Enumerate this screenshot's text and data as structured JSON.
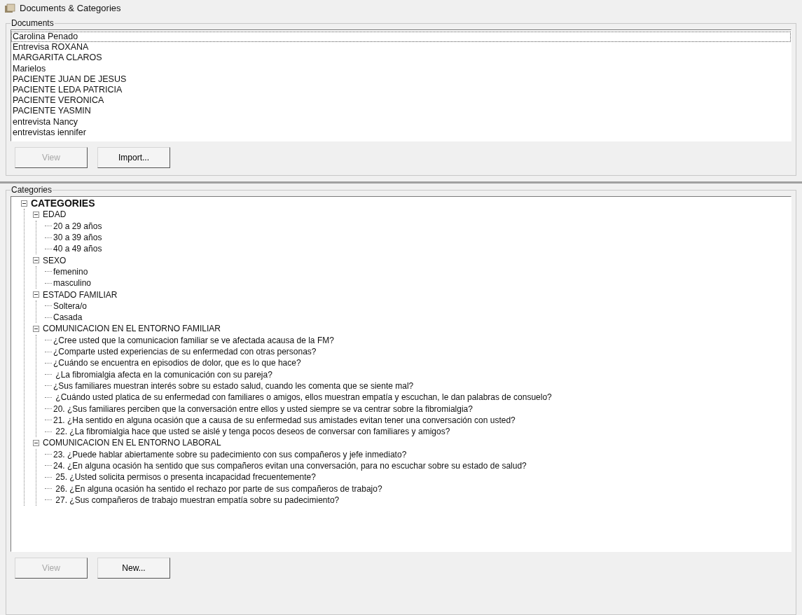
{
  "window": {
    "title": "Documents & Categories"
  },
  "documents": {
    "label": "Documents",
    "items": [
      {
        "label": "Carolina Penado",
        "focused": true
      },
      {
        "label": "Entrevisa ROXANA",
        "focused": false
      },
      {
        "label": "MARGARITA CLAROS",
        "focused": false
      },
      {
        "label": "Marielos",
        "focused": false
      },
      {
        "label": "PACIENTE JUAN DE JESUS",
        "focused": false
      },
      {
        "label": "PACIENTE LEDA PATRICIA",
        "focused": false
      },
      {
        "label": "PACIENTE VERONICA",
        "focused": false
      },
      {
        "label": "PACIENTE YASMIN",
        "focused": false
      },
      {
        "label": "entrevista Nancy",
        "focused": false
      },
      {
        "label": "entrevistas iennifer",
        "focused": false
      }
    ],
    "buttons": [
      {
        "label": "View",
        "disabled": true
      },
      {
        "label": "Import...",
        "disabled": false
      }
    ]
  },
  "categories": {
    "label": "Categories",
    "tree": [
      {
        "label": "CATEGORIES",
        "expanded": true,
        "children": [
          {
            "label": "EDAD",
            "expanded": true,
            "children": [
              {
                "label": "20 a 29 años"
              },
              {
                "label": "30 a 39 años"
              },
              {
                "label": "40 a 49 años"
              }
            ]
          },
          {
            "label": "SEXO",
            "expanded": true,
            "children": [
              {
                "label": "femenino"
              },
              {
                "label": "masculino"
              }
            ]
          },
          {
            "label": "ESTADO FAMILIAR",
            "expanded": true,
            "children": [
              {
                "label": "Soltera/o"
              },
              {
                "label": "Casada"
              }
            ]
          },
          {
            "label": "COMUNICACION EN EL ENTORNO FAMILIAR",
            "expanded": true,
            "children": [
              {
                "label": "¿Cree usted que la comunicacion familiar se ve afectada acausa de la FM?"
              },
              {
                "label": "¿Comparte usted experiencias de su enfermedad con otras personas?"
              },
              {
                "label": "¿Cuándo se encuentra en episodios de dolor, que es lo que hace?"
              },
              {
                "label": " ¿La fibromialgia afecta en la comunicación con su pareja?"
              },
              {
                "label": "¿Sus familiares muestran interés sobre su estado salud, cuando les comenta que se siente mal?"
              },
              {
                "label": " ¿Cuándo usted platica de su enfermedad con familiares o amigos, ellos muestran empatía y escuchan, le dan palabras de consuelo?"
              },
              {
                "label": "20. ¿Sus familiares perciben que la conversación entre ellos y usted siempre se va centrar sobre la fibromialgia?"
              },
              {
                "label": "21. ¿Ha sentido en alguna ocasión que a causa de su enfermedad sus amistades evitan tener una conversación con usted?"
              },
              {
                "label": " 22. ¿La fibromialgia hace que usted se aislé y tenga pocos deseos de conversar con familiares y amigos?"
              }
            ]
          },
          {
            "label": "COMUNICACION EN EL ENTORNO LABORAL",
            "expanded": true,
            "children": [
              {
                "label": "23. ¿Puede hablar abiertamente sobre su padecimiento con sus compañeros y jefe inmediato?"
              },
              {
                "label": "24. ¿En alguna ocasión ha sentido que sus compañeros evitan una conversación, para no escuchar sobre su estado de salud?"
              },
              {
                "label": " 25. ¿Usted solicita permisos o presenta incapacidad frecuentemente?"
              },
              {
                "label": " 26. ¿En alguna ocasión ha sentido el rechazo por parte de sus compañeros de trabajo?"
              },
              {
                "label": " 27. ¿Sus compañeros de trabajo muestran empatía sobre su padecimiento?"
              }
            ]
          }
        ]
      }
    ],
    "buttons": [
      {
        "label": "View",
        "disabled": true
      },
      {
        "label": "New...",
        "disabled": false
      }
    ]
  }
}
